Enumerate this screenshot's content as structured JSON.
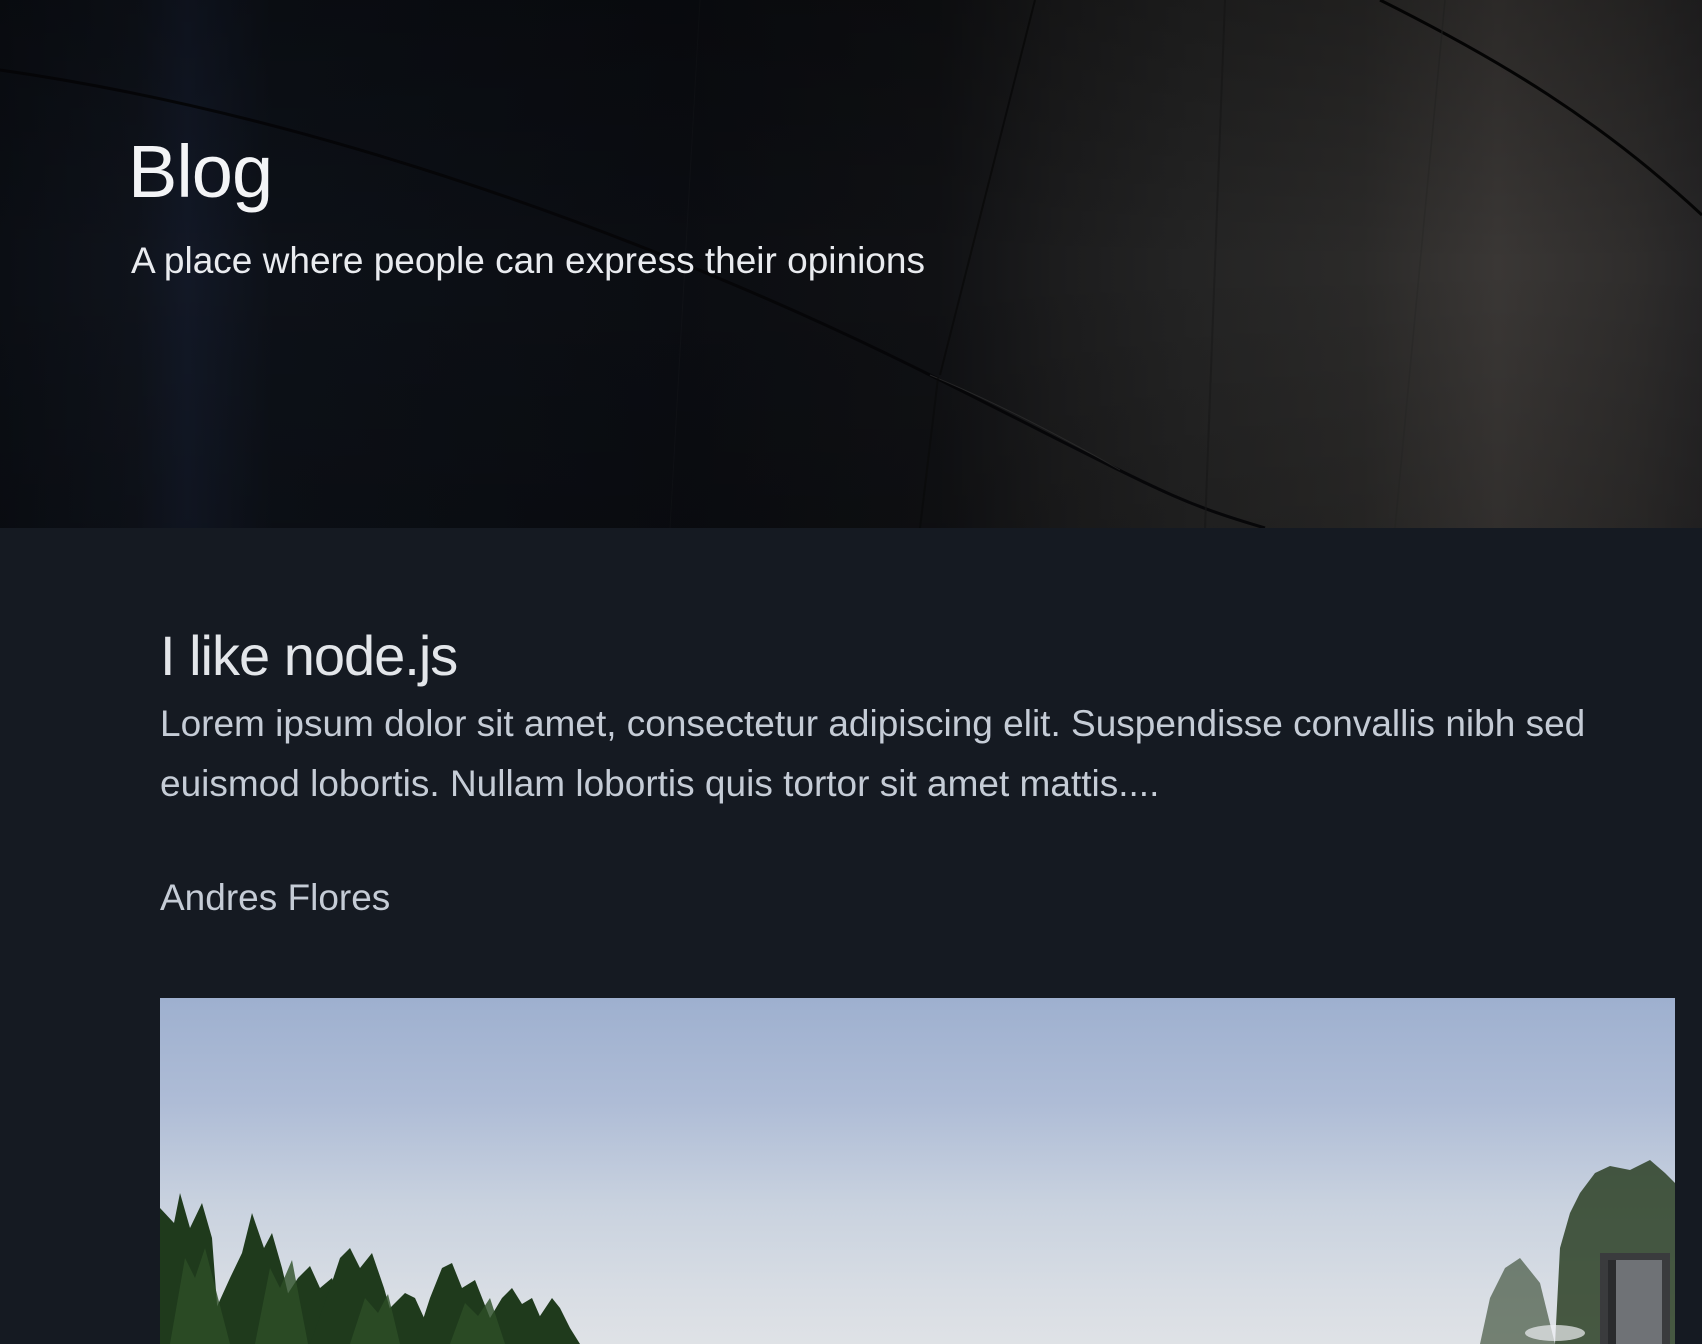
{
  "hero": {
    "title": "Blog",
    "subtitle": "A place where people can express their opinions"
  },
  "post": {
    "title": "I like node.js",
    "excerpt": "Lorem ipsum dolor sit amet, consectetur adipiscing elit. Suspendisse convallis nibh sed euismod lobortis. Nullam lobortis quis tortor sit amet mattis....",
    "author": "Andres Flores"
  },
  "colors": {
    "page_background": "#151a22",
    "hero_text": "#f3f4f6",
    "body_text": "#c5ccd6"
  }
}
